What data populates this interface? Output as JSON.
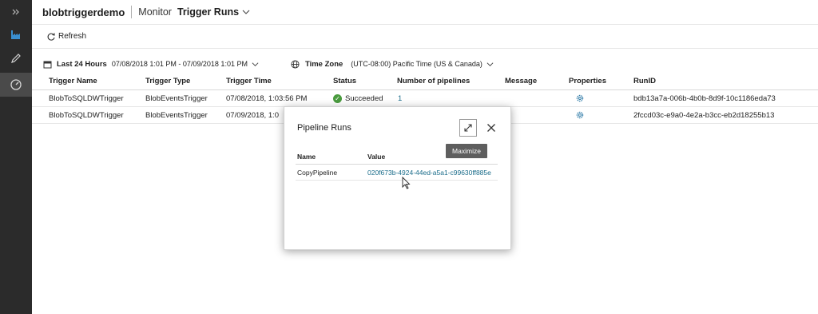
{
  "rail": {
    "items": [
      {
        "icon": "expand-chevrons-icon"
      },
      {
        "icon": "factory-icon"
      },
      {
        "icon": "pencil-icon"
      },
      {
        "icon": "monitor-gauge-icon"
      }
    ]
  },
  "header": {
    "factory_name": "blobtriggerdemo",
    "section": "Monitor",
    "page": "Trigger Runs"
  },
  "toolbar": {
    "refresh_label": "Refresh"
  },
  "filters": {
    "range_label": "Last 24 Hours",
    "range_value": "07/08/2018 1:01 PM - 07/09/2018 1:01 PM",
    "tz_label": "Time Zone",
    "tz_value": "(UTC-08:00) Pacific Time (US & Canada)"
  },
  "table": {
    "headers": [
      "Trigger Name",
      "Trigger Type",
      "Trigger Time",
      "Status",
      "Number of pipelines",
      "Message",
      "Properties",
      "RunID"
    ],
    "rows": [
      {
        "name": "BlobToSQLDWTrigger",
        "type": "BlobEventsTrigger",
        "time": "07/08/2018, 1:03:56 PM",
        "status": "Succeeded",
        "pipelines": "1",
        "message": "",
        "runid": "bdb13a7a-006b-4b0b-8d9f-10c1186eda73"
      },
      {
        "name": "BlobToSQLDWTrigger",
        "type": "BlobEventsTrigger",
        "time": "07/09/2018, 1:0",
        "status": "",
        "pipelines": "",
        "message": "",
        "runid": "2fccd03c-e9a0-4e2a-b3cc-eb2d18255b13"
      }
    ]
  },
  "dialog": {
    "title": "Pipeline Runs",
    "tooltip": "Maximize",
    "col_name": "Name",
    "col_value": "Value",
    "row_name": "CopyPipeline",
    "row_value": "020f673b-4924-44ed-a5a1-c99630ff885e"
  },
  "colors": {
    "rail_bg": "#2b2b2b",
    "link": "#1a6c8a",
    "success": "#4a9b3f"
  }
}
